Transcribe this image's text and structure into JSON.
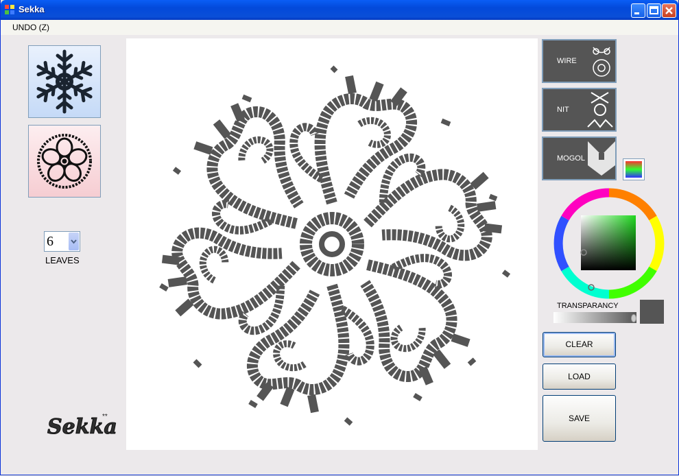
{
  "window": {
    "title": "Sekka",
    "title_icon": "app-icon"
  },
  "menu": {
    "undo_label": "UNDO (Z)"
  },
  "left": {
    "patterns": [
      {
        "name": "snowflake-pattern",
        "bg": "#d7e6fb"
      },
      {
        "name": "flower-pattern",
        "bg": "#f8d9dc"
      }
    ],
    "leaves_value": "6",
    "leaves_label": "LEAVES",
    "logo_text": "SEKKA"
  },
  "styles": [
    {
      "label": "WIRE"
    },
    {
      "label": "NIT"
    },
    {
      "label": "MOGOL"
    }
  ],
  "color": {
    "current": "#555555",
    "transparency_label": "TRANSPARANCY"
  },
  "buttons": {
    "clear": "CLEAR",
    "load": "LOAD",
    "save": "SAVE"
  },
  "canvas": {
    "stroke_color": "#555555",
    "symmetry": 6
  }
}
